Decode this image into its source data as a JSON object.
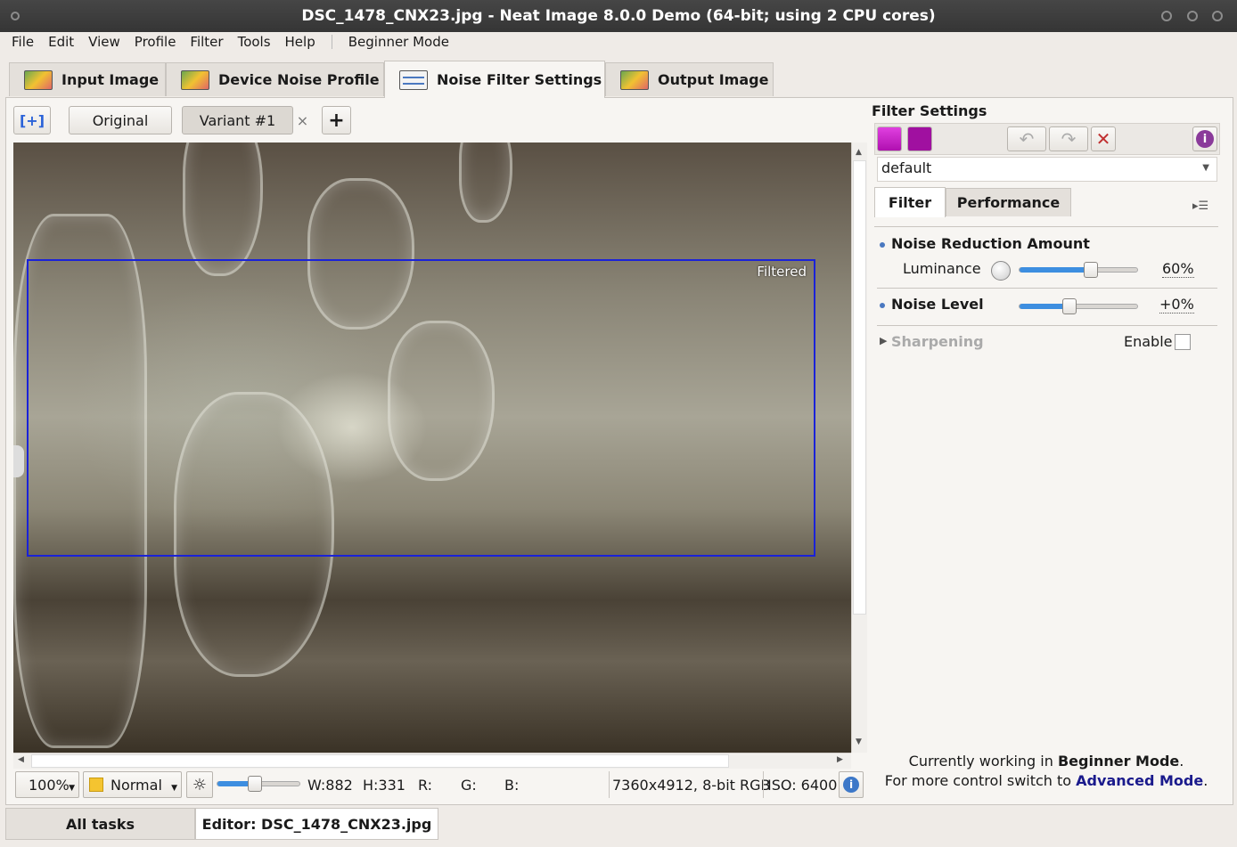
{
  "window": {
    "title": "DSC_1478_CNX23.jpg - Neat Image 8.0.0 Demo (64-bit; using 2 CPU cores)"
  },
  "menu": {
    "items": [
      "File",
      "Edit",
      "View",
      "Profile",
      "Filter",
      "Tools",
      "Help"
    ],
    "mode": "Beginner Mode"
  },
  "main_tabs": [
    {
      "label": "Input Image",
      "icon": "image-icon"
    },
    {
      "label": "Device Noise Profile",
      "icon": "profile-icon"
    },
    {
      "label": "Noise Filter Settings",
      "icon": "sliders-icon",
      "active": true
    },
    {
      "label": "Output Image",
      "icon": "image-icon"
    }
  ],
  "variants": {
    "original": "Original",
    "variant1": "Variant #1",
    "close": "×",
    "add": "+"
  },
  "preview": {
    "filtered_label": "Filtered"
  },
  "status": {
    "zoom": "100%",
    "mode": "Normal",
    "w": "W:882",
    "h": "H:331",
    "r": "R:",
    "g": "G:",
    "b": "B:",
    "image_info": "7360x4912, 8-bit RGB",
    "iso": "ISO: 6400",
    "brightness_level": 0.45
  },
  "panel": {
    "title": "Filter Settings",
    "preset": "default",
    "tabs": [
      "Filter",
      "Performance"
    ],
    "noise_reduction": {
      "header": "Noise Reduction Amount",
      "luminance_label": "Luminance",
      "luminance_value": "60%",
      "luminance_fraction": 0.6
    },
    "noise_level": {
      "header": "Noise Level",
      "value": "+0%",
      "fraction": 0.42
    },
    "sharpening": {
      "header": "Sharpening",
      "enable_label": "Enable"
    },
    "footer_line1_prefix": "Currently working in ",
    "footer_line1_bold": "Beginner Mode",
    "footer_line1_suffix": ".",
    "footer_line2_prefix": "For more control switch to ",
    "footer_line2_link": "Advanced Mode",
    "footer_line2_suffix": "."
  },
  "bottom_tabs": [
    "All tasks",
    "Editor: DSC_1478_CNX23.jpg"
  ],
  "colors": {
    "accent": "#3d8ee0",
    "link": "#1a1a8c",
    "selection_box": "#1a22d8"
  }
}
